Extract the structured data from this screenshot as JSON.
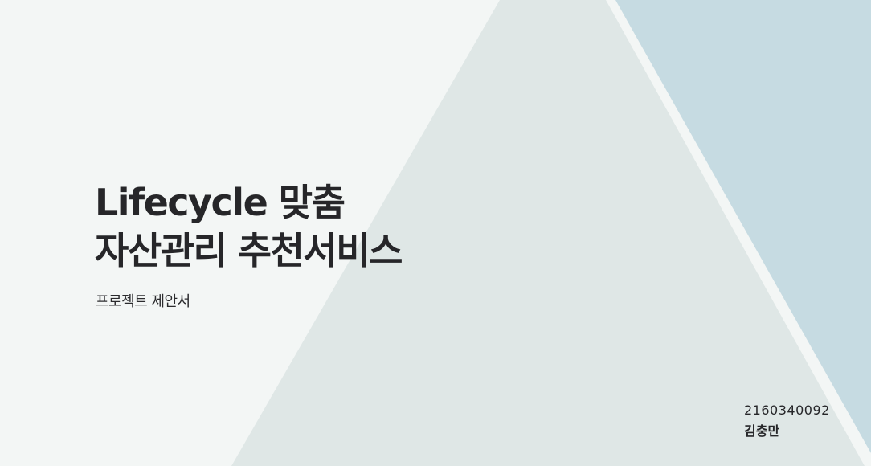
{
  "slide": {
    "title_line_1": "Lifecycle 맞춤",
    "title_line_2": "자산관리 추천서비스",
    "subtitle": "프로젝트 제안서",
    "student_id": "2160340092",
    "author_name": "김충만"
  },
  "colors": {
    "background": "#f3f6f5",
    "triangle_fill": "#dfe7e6",
    "right_panel_fill": "#c6dbe2",
    "divider_stripe": "#f3f6f5",
    "title_text": "#262629"
  }
}
